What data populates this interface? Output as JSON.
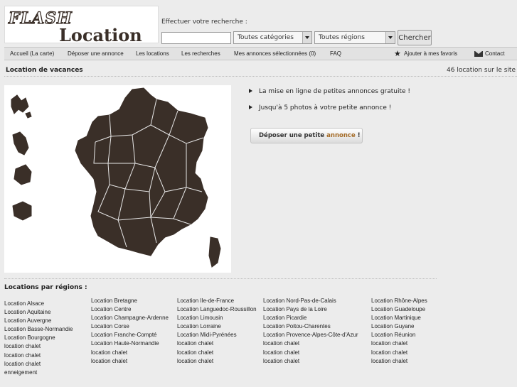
{
  "logo": {
    "line1": "FLASH",
    "line2": "Location"
  },
  "search": {
    "label": "Effectuer votre recherche :",
    "query": "",
    "category": "Toutes catégories",
    "region": "Toutes régions",
    "button": "Chercher"
  },
  "nav": {
    "items": [
      "Accueil (La carte)",
      "Déposer une annonce",
      "Les locations",
      "Les recherches",
      "Mes annonces sélectionnées (0)",
      "FAQ"
    ],
    "favorites": "Ajouter à mes favoris",
    "contact": "Contact"
  },
  "page": {
    "title": "Location de vacances",
    "count": "46 location sur le site"
  },
  "promo": {
    "line1": "La mise en ligne de petites annonces gratuite !",
    "line2": "Jusqu'à 5 photos à votre petite annonce !",
    "button_part1": "Déposer une petite",
    "button_part2": "annonce",
    "button_part3": "!"
  },
  "regions": {
    "title": "Locations par régions :",
    "columns": [
      [
        "Location Alsace",
        "Location Aquitaine",
        "Location Auvergne",
        "Location Basse-Normandie",
        "Location Bourgogne",
        "location chalet",
        "location chalet",
        "location chalet",
        "enneigement"
      ],
      [
        "Location Bretagne",
        "Location Centre",
        "Location Champagne-Ardenne",
        "Location Corse",
        "Location Franche-Compté",
        "Location Haute-Normandie",
        "location chalet",
        "location chalet"
      ],
      [
        "Location Ile-de-France",
        "Location Languedoc-Roussillon",
        "Location Limousin",
        "Location Lorraine",
        "Location Midi-Pyrénées",
        "location chalet",
        "location chalet",
        "location chalet"
      ],
      [
        "Location Nord-Pas-de-Calais",
        "Location Pays de la Loire",
        "Location Picardie",
        "Location Poitou-Charentes",
        "Location Provence-Alpes-Côte-d'Azur",
        "location chalet",
        "location chalet",
        "location chalet"
      ],
      [
        "Location Rhône-Alpes",
        "Location Guadeloupe",
        "Location Martinique",
        "Location Guyane",
        "Location Réunion",
        "location chalet",
        "location chalet",
        "location chalet"
      ]
    ]
  },
  "icons": {
    "star": "star-icon",
    "mail": "envelope-icon",
    "map": "france-map"
  },
  "colors": {
    "map_fill": "#3a2f28",
    "accent": "#a56c28"
  }
}
